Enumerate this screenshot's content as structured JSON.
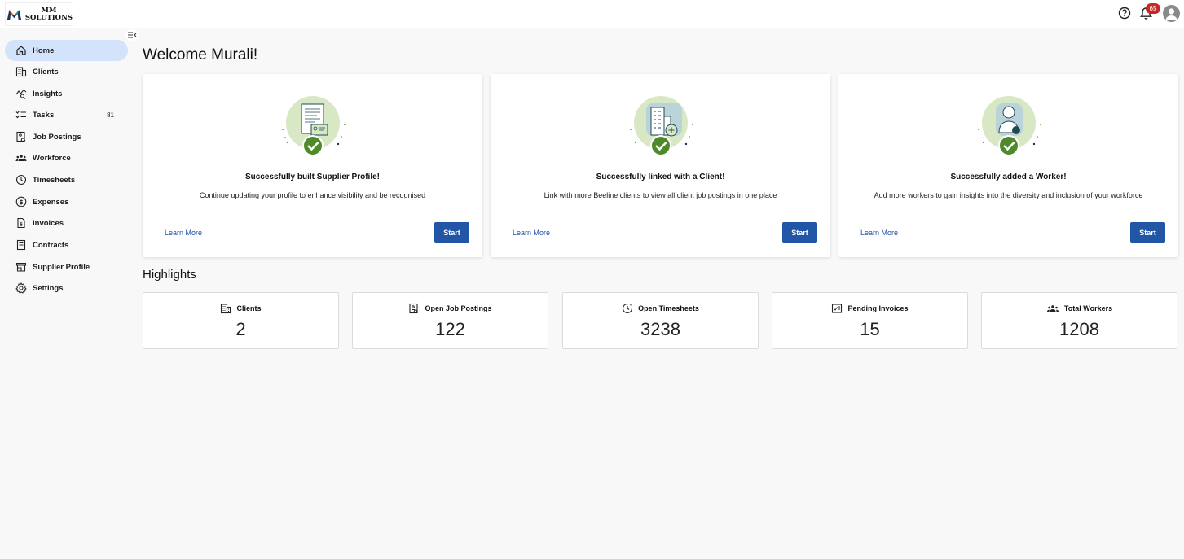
{
  "brand": {
    "line1": "MM",
    "line2": "SOLUTIONS"
  },
  "header": {
    "notification_count": "65"
  },
  "sidebar": {
    "items": [
      {
        "label": "Home",
        "icon": "home-icon",
        "active": true
      },
      {
        "label": "Clients",
        "icon": "building-icon"
      },
      {
        "label": "Insights",
        "icon": "insights-icon"
      },
      {
        "label": "Tasks",
        "icon": "checklist-icon",
        "count": "81"
      },
      {
        "label": "Job Postings",
        "icon": "job-postings-icon"
      },
      {
        "label": "Workforce",
        "icon": "people-icon"
      },
      {
        "label": "Timesheets",
        "icon": "clock-icon"
      },
      {
        "label": "Expenses",
        "icon": "dollar-icon"
      },
      {
        "label": "Invoices",
        "icon": "invoice-icon"
      },
      {
        "label": "Contracts",
        "icon": "contract-icon"
      },
      {
        "label": "Supplier Profile",
        "icon": "store-icon"
      },
      {
        "label": "Settings",
        "icon": "gear-icon"
      }
    ]
  },
  "main": {
    "welcome": "Welcome Murali!",
    "cards": [
      {
        "title": "Successfully built Supplier Profile!",
        "desc": "Continue updating your profile to enhance visibility and be recognised",
        "learn": "Learn More",
        "start": "Start"
      },
      {
        "title": "Successfully linked with a Client!",
        "desc": "Link with more Beeline clients to view all client job postings in one place",
        "learn": "Learn More",
        "start": "Start"
      },
      {
        "title": "Successfully added a Worker!",
        "desc": "Add more workers to gain insights into the diversity and inclusion of your workforce",
        "learn": "Learn More",
        "start": "Start"
      }
    ],
    "highlights_title": "Highlights",
    "highlights": [
      {
        "label": "Clients",
        "value": "2",
        "icon": "building-icon"
      },
      {
        "label": "Open Job Postings",
        "value": "122",
        "icon": "job-postings-icon"
      },
      {
        "label": "Open Timesheets",
        "value": "3238",
        "icon": "clock-icon"
      },
      {
        "label": "Pending Invoices",
        "value": "15",
        "icon": "invoice-icon"
      },
      {
        "label": "Total Workers",
        "value": "1208",
        "icon": "people-icon"
      }
    ]
  },
  "colors": {
    "accent": "#2156a6",
    "active_nav": "#d3e3fb",
    "success": "#4e8a2a",
    "illus_bg": "#d9e8c4",
    "badge": "#c62828"
  }
}
